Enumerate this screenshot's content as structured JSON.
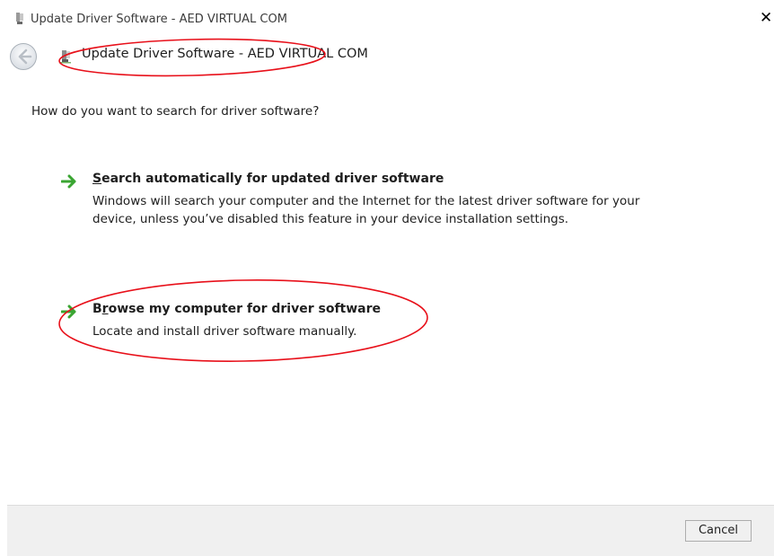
{
  "window": {
    "title": "Update Driver Software - AED VIRTUAL COM",
    "close_glyph": "✕"
  },
  "navbar": {
    "title": "Update Driver Software - AED VIRTUAL COM",
    "back_icon": "back-arrow-icon",
    "device_icon": "device-icon"
  },
  "content": {
    "question": "How do you want to search for driver software?",
    "options": [
      {
        "title": "Search automatically for updated driver software",
        "access_key": "S",
        "description": "Windows will search your computer and the Internet for the latest driver software for your device, unless you’ve disabled this feature in your device installation settings.",
        "icon": "green-arrow-icon"
      },
      {
        "title": "Browse my computer for driver software",
        "access_key": "r",
        "description": "Locate and install driver software manually.",
        "icon": "green-arrow-icon"
      }
    ]
  },
  "footer": {
    "cancel_label": "Cancel"
  },
  "colors": {
    "annotation_red": "#e8101a",
    "arrow_green": "#3aa532",
    "footer_bg": "#f0f0f0"
  }
}
